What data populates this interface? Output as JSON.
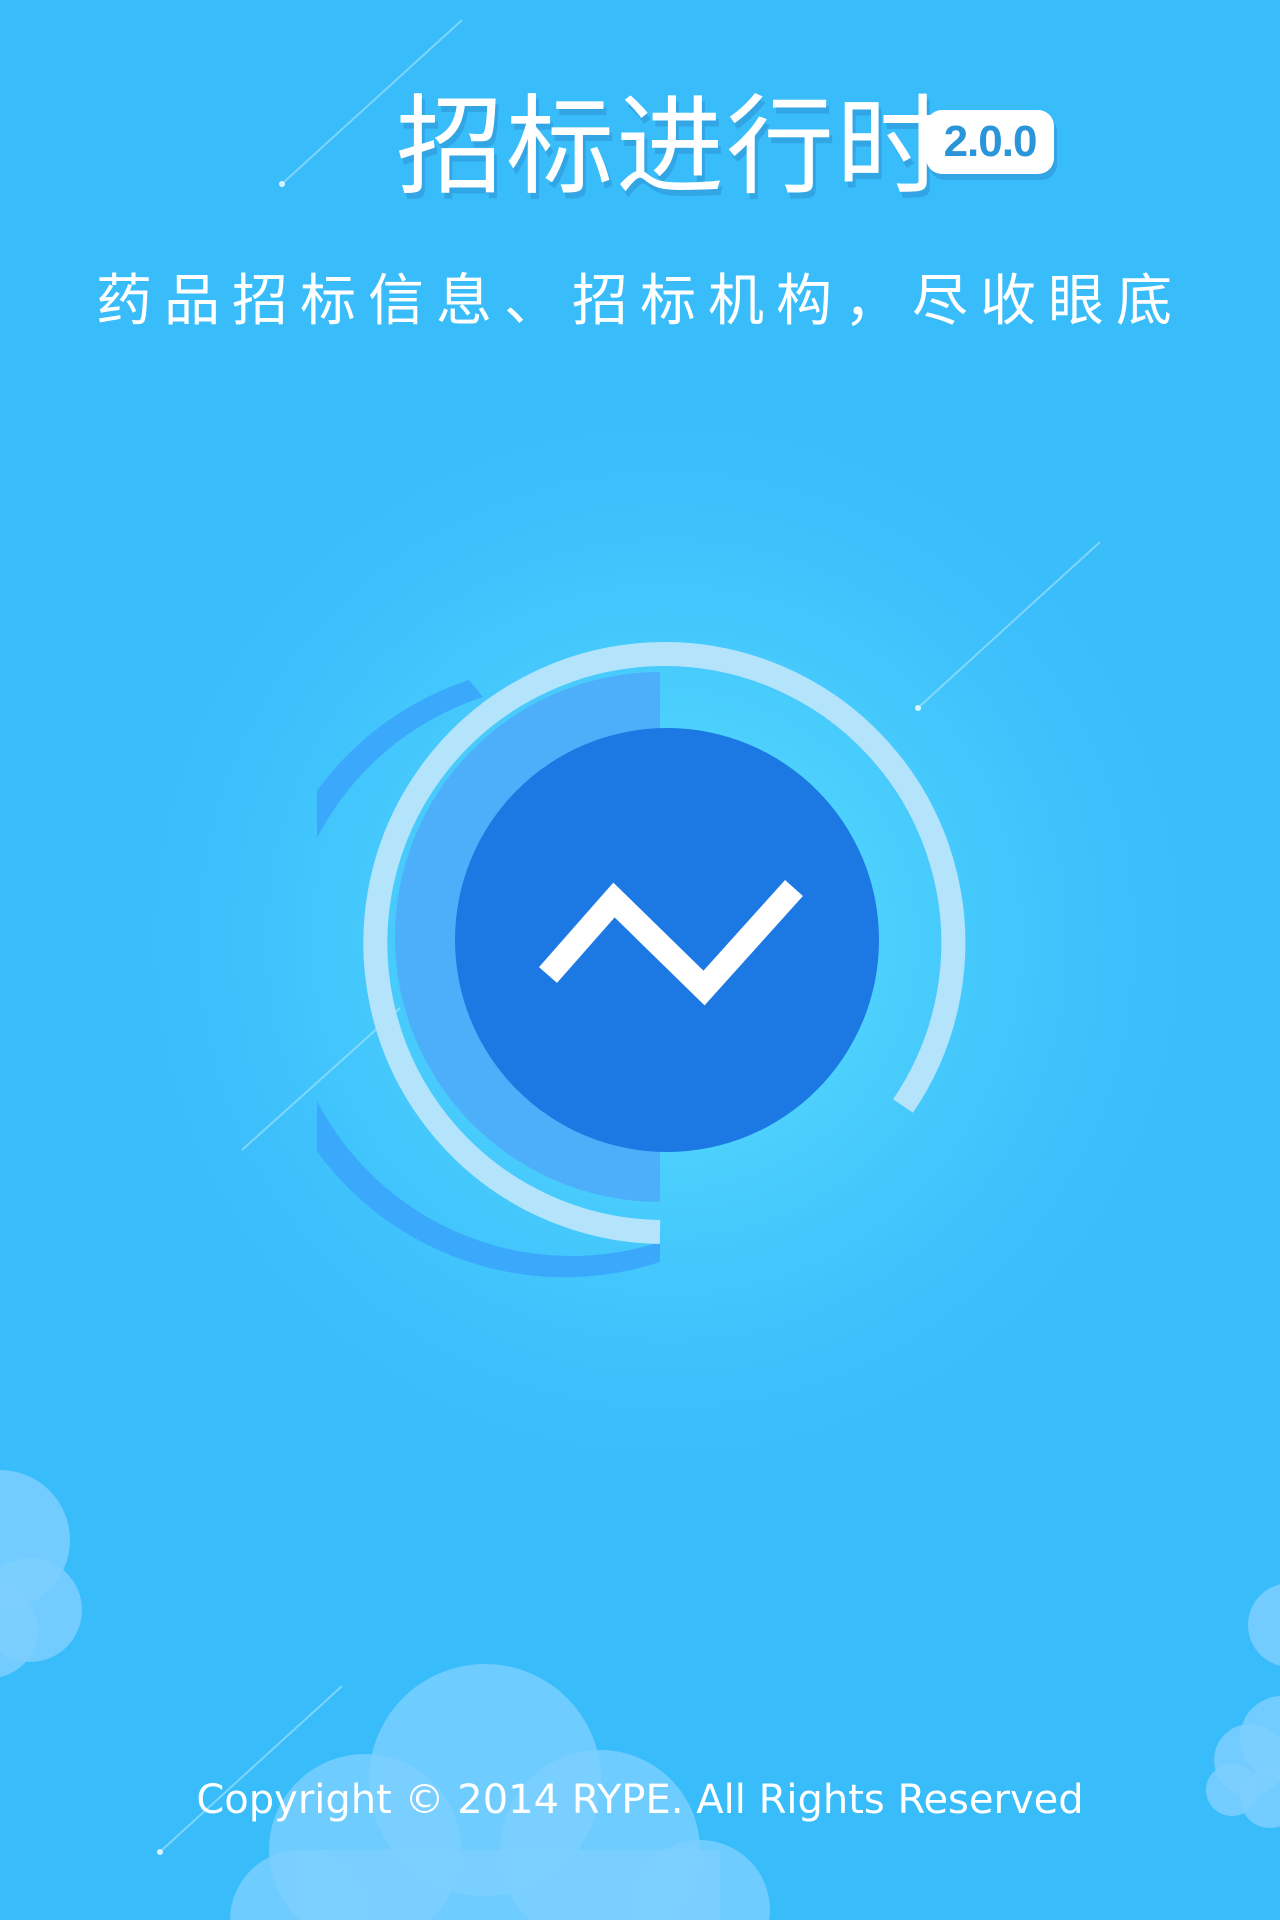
{
  "splash": {
    "app_title": "招标进行时",
    "version": "2.0.0",
    "tagline": "药品招标信息、招标机构，尽收眼底",
    "copyright": "Copyright © 2014 RYPE. All Rights Reserved"
  },
  "colors": {
    "background": "#38bdfa",
    "glow": "#5ee0ff",
    "logo_center": "#1c78e3",
    "logo_half_ring": "#4daffa",
    "logo_outer_ring": "#b3e4fb",
    "logo_left_arc": "#3aa8fb",
    "cloud": "#7ccfff",
    "text": "#ffffff"
  },
  "icons": {
    "logo": "trend-line-circle-logo",
    "clouds": "cloud-decoration"
  }
}
